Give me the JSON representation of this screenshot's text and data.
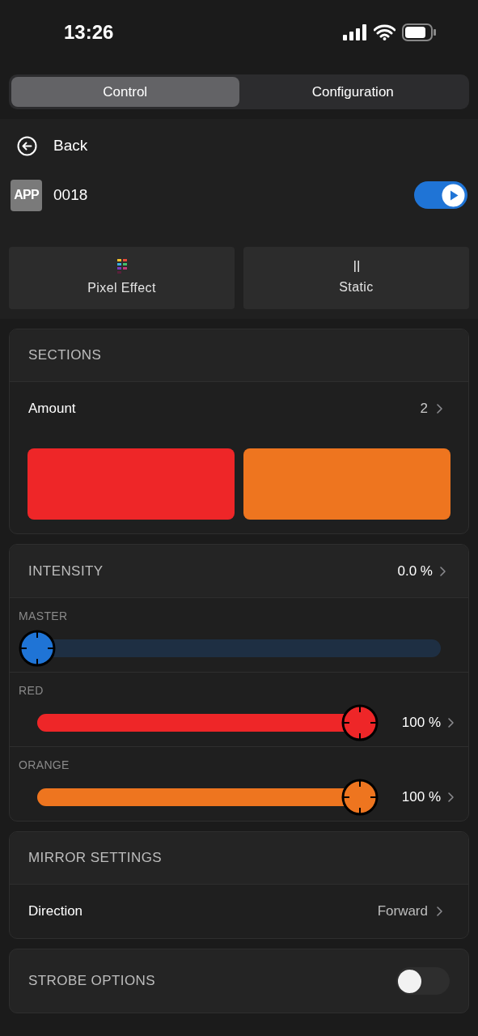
{
  "status_bar": {
    "time": "13:26"
  },
  "tabs": [
    {
      "label": "Control",
      "selected": true
    },
    {
      "label": "Configuration",
      "selected": false
    }
  ],
  "back": {
    "label": "Back"
  },
  "device": {
    "badge": "APP",
    "name": "0018",
    "on": true
  },
  "modes": [
    {
      "label": "Pixel Effect",
      "kind": "pixel"
    },
    {
      "label": "Static",
      "kind": "static"
    }
  ],
  "sections": {
    "title": "SECTIONS",
    "amount_label": "Amount",
    "amount": "2",
    "swatches": [
      {
        "color": "#ee2628"
      },
      {
        "color": "#ee751f"
      }
    ]
  },
  "intensity": {
    "title": "INTENSITY",
    "value": "0.0 %",
    "channels": [
      {
        "name": "MASTER",
        "level": 0,
        "color": "#1f74d6"
      },
      {
        "name": "RED",
        "level": 1,
        "color": "#ee2628",
        "reading": "100 %"
      },
      {
        "name": "ORANGE",
        "level": 1,
        "color": "#ee751f",
        "reading": "100 %"
      }
    ]
  },
  "mirror": {
    "title": "MIRROR SETTINGS",
    "label": "Direction",
    "value": "Forward"
  },
  "strobe": {
    "title": "STROBE OPTIONS",
    "on": false
  }
}
